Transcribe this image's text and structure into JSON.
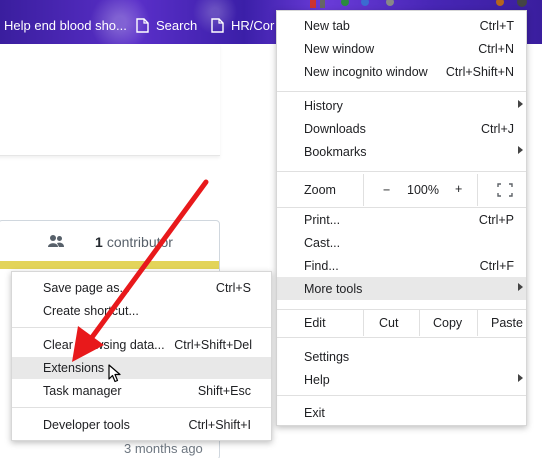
{
  "bookmarks": {
    "items": [
      {
        "label": "Help end blood sho..."
      },
      {
        "label": "Search"
      },
      {
        "label": "HR/Cor"
      }
    ]
  },
  "page": {
    "contributor_count": "1",
    "contributor_label": "contributor",
    "timestamp": "3 months ago"
  },
  "chrome_menu": {
    "new_tab": {
      "label": "New tab",
      "shortcut": "Ctrl+T"
    },
    "new_window": {
      "label": "New window",
      "shortcut": "Ctrl+N"
    },
    "new_incognito": {
      "label": "New incognito window",
      "shortcut": "Ctrl+Shift+N"
    },
    "history": {
      "label": "History"
    },
    "downloads": {
      "label": "Downloads",
      "shortcut": "Ctrl+J"
    },
    "bookmarks": {
      "label": "Bookmarks"
    },
    "zoom": {
      "label": "Zoom",
      "minus": "−",
      "value": "100%",
      "plus": "+"
    },
    "print": {
      "label": "Print...",
      "shortcut": "Ctrl+P"
    },
    "cast": {
      "label": "Cast..."
    },
    "find": {
      "label": "Find...",
      "shortcut": "Ctrl+F"
    },
    "more_tools": {
      "label": "More tools"
    },
    "edit": {
      "label": "Edit",
      "cut": "Cut",
      "copy": "Copy",
      "paste": "Paste"
    },
    "settings": {
      "label": "Settings"
    },
    "help": {
      "label": "Help"
    },
    "exit": {
      "label": "Exit"
    }
  },
  "more_tools_menu": {
    "save_page": {
      "label": "Save page as...",
      "shortcut": "Ctrl+S"
    },
    "create_shortcut": {
      "label": "Create shortcut..."
    },
    "clear_browsing": {
      "label": "Clear browsing data...",
      "shortcut": "Ctrl+Shift+Del"
    },
    "extensions": {
      "label": "Extensions"
    },
    "task_manager": {
      "label": "Task manager",
      "shortcut": "Shift+Esc"
    },
    "developer_tools": {
      "label": "Developer tools",
      "shortcut": "Ctrl+Shift+I"
    }
  },
  "colors": {
    "annotation_arrow": "#e8191b",
    "bookmarks_bar": "#4a27b8",
    "menu_hover": "#e8e8e8",
    "progress_bar": "#e3d45a"
  }
}
